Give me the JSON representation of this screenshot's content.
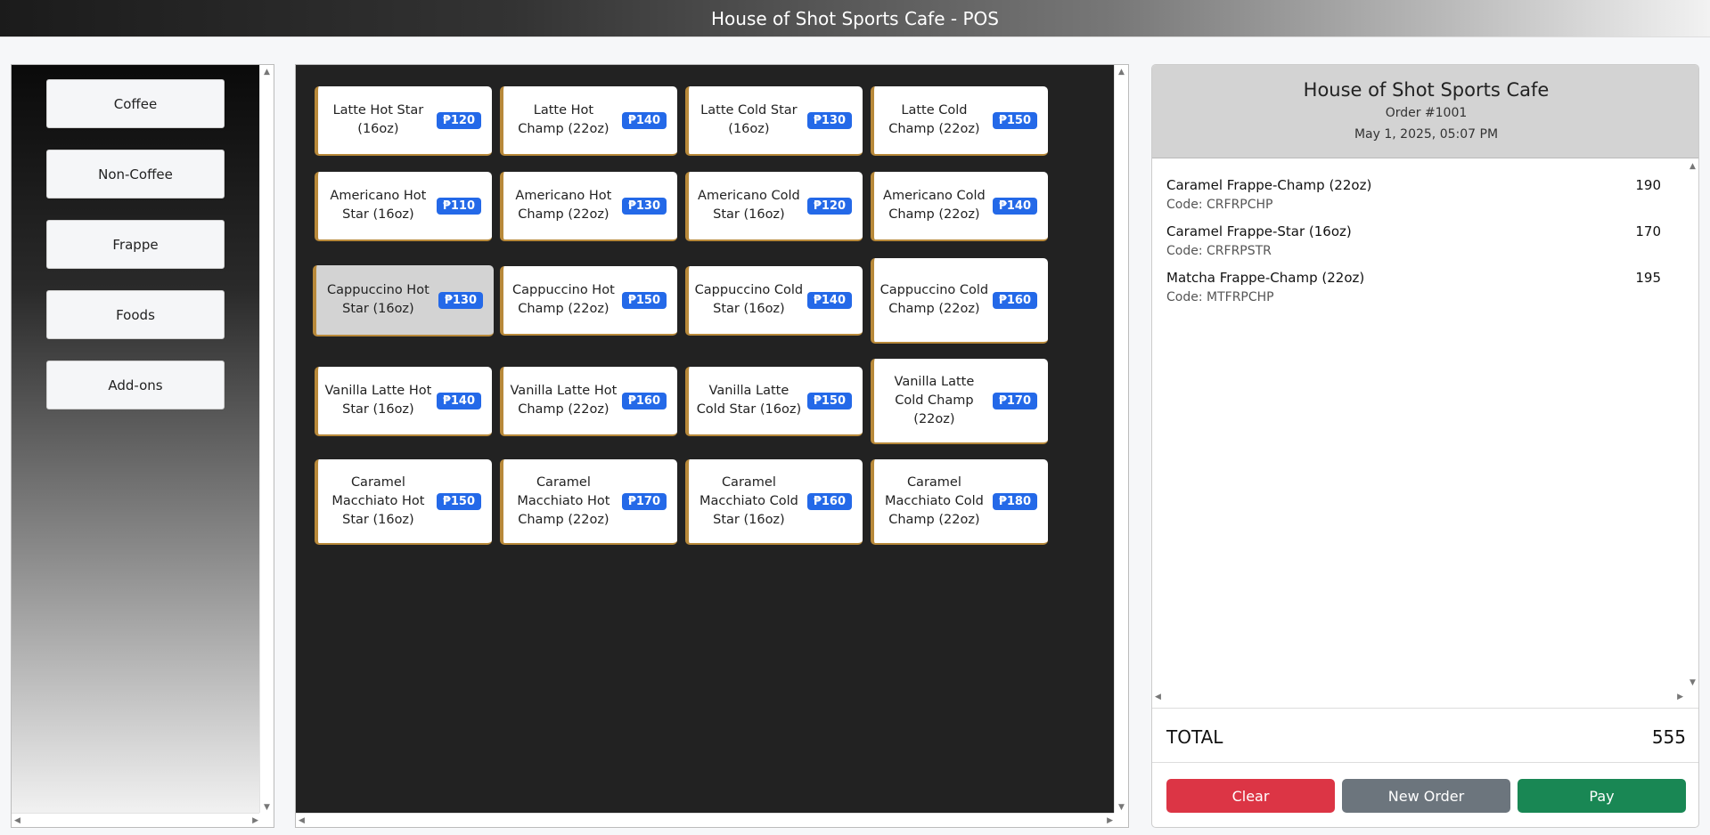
{
  "window": {
    "title": "House of Shot Sports Cafe - POS"
  },
  "categories": [
    {
      "label": "Coffee"
    },
    {
      "label": "Non-Coffee"
    },
    {
      "label": "Frappe"
    },
    {
      "label": "Foods"
    },
    {
      "label": "Add-ons"
    }
  ],
  "products": [
    {
      "name": "Latte Hot Star (16oz)",
      "price": "₱120"
    },
    {
      "name": "Latte Hot Champ (22oz)",
      "price": "₱140"
    },
    {
      "name": "Latte Cold Star (16oz)",
      "price": "₱130"
    },
    {
      "name": "Latte Cold Champ (22oz)",
      "price": "₱150"
    },
    {
      "name": "Americano Hot Star (16oz)",
      "price": "₱110"
    },
    {
      "name": "Americano Hot Champ (22oz)",
      "price": "₱130"
    },
    {
      "name": "Americano Cold Star (16oz)",
      "price": "₱120"
    },
    {
      "name": "Americano Cold Champ (22oz)",
      "price": "₱140"
    },
    {
      "name": "Cappuccino Hot Star (16oz)",
      "price": "₱130",
      "selected": true
    },
    {
      "name": "Cappuccino Hot Champ (22oz)",
      "price": "₱150"
    },
    {
      "name": "Cappuccino Cold Star (16oz)",
      "price": "₱140"
    },
    {
      "name": "Cappuccino Cold Champ (22oz)",
      "price": "₱160"
    },
    {
      "name": "Vanilla Latte Hot Star (16oz)",
      "price": "₱140"
    },
    {
      "name": "Vanilla Latte Hot Champ (22oz)",
      "price": "₱160"
    },
    {
      "name": "Vanilla Latte Cold Star (16oz)",
      "price": "₱150"
    },
    {
      "name": "Vanilla Latte Cold Champ (22oz)",
      "price": "₱170"
    },
    {
      "name": "Caramel Macchiato Hot Star (16oz)",
      "price": "₱150"
    },
    {
      "name": "Caramel Macchiato Hot Champ (22oz)",
      "price": "₱170"
    },
    {
      "name": "Caramel Macchiato Cold Star (16oz)",
      "price": "₱160"
    },
    {
      "name": "Caramel Macchiato Cold Champ (22oz)",
      "price": "₱180"
    }
  ],
  "receipt": {
    "shop_name": "House of Shot Sports Cafe",
    "order_number": "Order #1001",
    "date": "May 1, 2025, 05:07 PM",
    "items": [
      {
        "name": "Caramel Frappe-Champ (22oz)",
        "price": "190",
        "code": "Code: CRFRPCHP"
      },
      {
        "name": "Caramel Frappe-Star (16oz)",
        "price": "170",
        "code": "Code: CRFRPSTR"
      },
      {
        "name": "Matcha Frappe-Champ (22oz)",
        "price": "195",
        "code": "Code: MTFRPCHP"
      }
    ],
    "total_label": "TOTAL",
    "total_value": "555"
  },
  "actions": {
    "clear_label": "Clear",
    "new_order_label": "New Order",
    "pay_label": "Pay"
  },
  "colors": {
    "price_badge": "#2469e8",
    "clear": "#dc3545",
    "new_order": "#6c757d",
    "pay": "#198754",
    "card_accent": "#b8893a"
  }
}
